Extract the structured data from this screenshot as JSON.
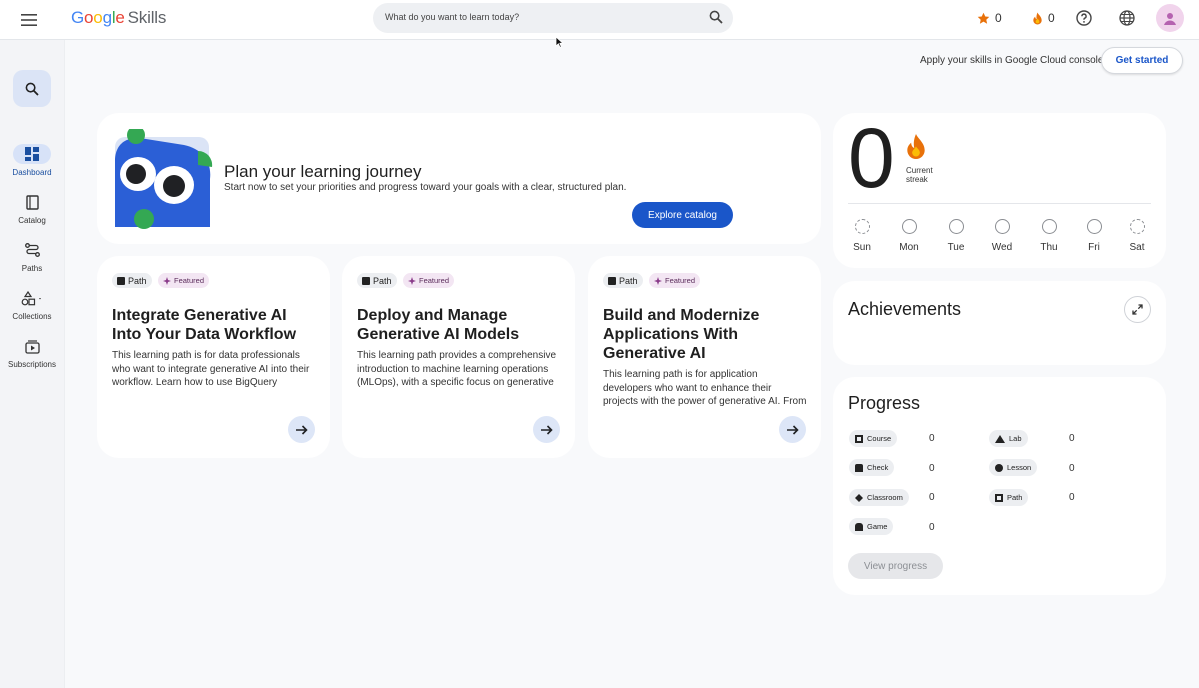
{
  "header": {
    "logo_google": [
      "G",
      "o",
      "o",
      "g",
      "l",
      "e"
    ],
    "logo_product": "Skills",
    "search_placeholder": "What do you want to learn today?",
    "stars_count": "0",
    "streak_count": "0"
  },
  "sidebar": {
    "items": [
      {
        "label": "Dashboard",
        "icon": "dashboard-icon"
      },
      {
        "label": "Catalog",
        "icon": "book-icon"
      },
      {
        "label": "Paths",
        "icon": "paths-icon"
      },
      {
        "label": "Collections",
        "icon": "shapes-icon"
      },
      {
        "label": "Subscriptions",
        "icon": "subscriptions-icon"
      }
    ]
  },
  "apply": {
    "text": "Apply your skills in Google Cloud console",
    "button": "Get started"
  },
  "hero": {
    "title": "Plan your learning journey",
    "subtitle": "Start now to set your priorities and progress toward your goals with a clear, structured plan.",
    "button": "Explore catalog"
  },
  "paths": [
    {
      "chip": "Path",
      "featured": "Featured",
      "title": "Integrate Generative AI Into Your Data Workflow",
      "description": "This learning path is for data professionals who want to integrate generative AI into their workflow. Learn how to use BigQuery Machin..."
    },
    {
      "chip": "Path",
      "featured": "Featured",
      "title": "Deploy and Manage Generative AI Models",
      "description": "This learning path provides a comprehensive introduction to machine learning operations (MLOps), with a specific focus on generative ..."
    },
    {
      "chip": "Path",
      "featured": "Featured",
      "title": "Build and Modernize Applications With Generative AI",
      "description": "This learning path is for application developers who want to enhance their projects with the power of generative AI. From understanding t..."
    }
  ],
  "streak": {
    "value": "0",
    "label_line1": "Current",
    "label_line2": "streak",
    "days": [
      "Sun",
      "Mon",
      "Tue",
      "Wed",
      "Thu",
      "Fri",
      "Sat"
    ]
  },
  "achievements": {
    "title": "Achievements"
  },
  "progress": {
    "title": "Progress",
    "items": [
      {
        "label": "Course",
        "value": "0",
        "icon": "course-icon"
      },
      {
        "label": "Lab",
        "value": "0",
        "icon": "lab-icon"
      },
      {
        "label": "Check",
        "value": "0",
        "icon": "check-icon"
      },
      {
        "label": "Lesson",
        "value": "0",
        "icon": "lesson-icon"
      },
      {
        "label": "Classroom",
        "value": "0",
        "icon": "classroom-icon"
      },
      {
        "label": "Path",
        "value": "0",
        "icon": "path-icon"
      },
      {
        "label": "Game",
        "value": "0",
        "icon": "game-icon"
      }
    ],
    "button": "View progress"
  },
  "colors": {
    "primary": "#1a56c9",
    "active_rail": "#d7e2f8",
    "featured_bg": "#f3e6f3",
    "streak_star": "#e8710a"
  }
}
